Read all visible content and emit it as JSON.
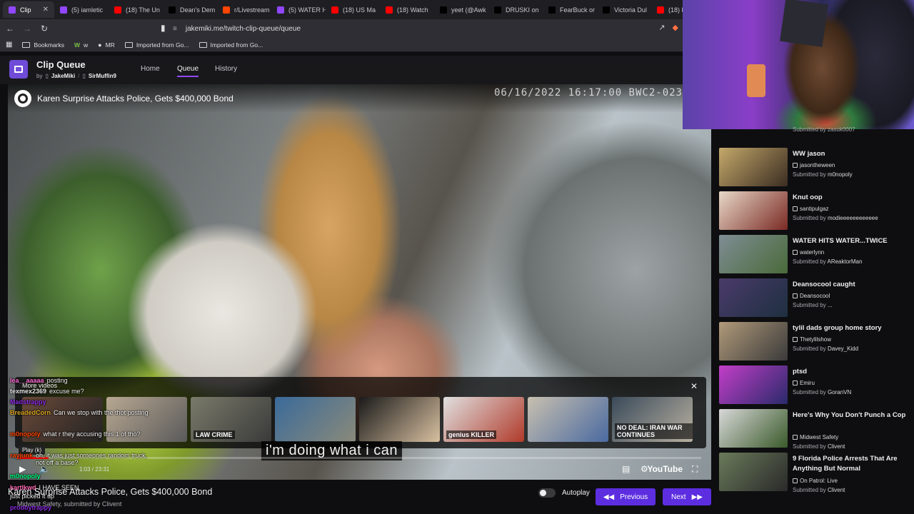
{
  "browser": {
    "tabs": [
      {
        "label": "Clip",
        "color": "#9147ff",
        "active": true
      },
      {
        "label": "(5) iamletic",
        "color": "#9147ff"
      },
      {
        "label": "(18) The Un",
        "color": "#ff0000"
      },
      {
        "label": "Dean's Dem",
        "color": "#000000"
      },
      {
        "label": "r/Livestream",
        "color": "#ff4500"
      },
      {
        "label": "(5) WATER H",
        "color": "#9147ff"
      },
      {
        "label": "(18) US Ma",
        "color": "#ff0000"
      },
      {
        "label": "(18) Watch",
        "color": "#ff0000"
      },
      {
        "label": "yeet (@Awk",
        "color": "#000000"
      },
      {
        "label": "DRUSKI on",
        "color": "#000000"
      },
      {
        "label": "FearBuck or",
        "color": "#000000"
      },
      {
        "label": "Victoria Dul",
        "color": "#000000"
      },
      {
        "label": "(18) L",
        "color": "#ff0000"
      }
    ],
    "url": "jakemiki.me/twitch-clip-queue/queue",
    "bookmarks": [
      "Bookmarks",
      "w",
      "MR",
      "Imported from Go...",
      "Imported from Go..."
    ]
  },
  "app": {
    "title": "Clip Queue",
    "by": "by",
    "author1": "JakeMiki",
    "author2": "SirMuffin9",
    "nav": [
      "Home",
      "Queue",
      "History"
    ]
  },
  "player": {
    "video_title": "Karen Surprise Attacks Police, Gets $400,000 Bond",
    "stamp": "06/16/2022 16:17:00   BWC2-023",
    "more_videos": "More videos",
    "caption": "i'm doing what i can",
    "time": "1:03 / 23:31",
    "play_tooltip": "Play (k)",
    "youtube": "YouTube",
    "progress": 0.045,
    "thumb_labels": [
      "",
      "",
      "LAW CRIME",
      "",
      "",
      "genius KILLER",
      "",
      "NO DEAL: IRAN WAR CONTINUES"
    ]
  },
  "chat": [
    {
      "user": "lea__aaaaa",
      "color": "#ff6ad5",
      "msg": "posting"
    },
    {
      "user": "texmex2369",
      "color": "#e8e8e8",
      "msg": "excuse me?"
    },
    {
      "user": "Madstrappy",
      "color": "#8a2be2",
      "msg": ""
    },
    {
      "user": "BreadedCorn",
      "color": "#daa520",
      "msg": "Can we stop with the thot posting"
    },
    {
      "user": "m0nopoly",
      "color": "#ff4500",
      "msg": "what r they accusing this 1 of tho?"
    },
    {
      "user": "rayjunk",
      "color": "#ff4500",
      "msg": "oh, it was just someones random truck, not off a base?"
    },
    {
      "user": "m0nopoly",
      "color": "#00ff7f",
      "msg": ""
    },
    {
      "user": "kartlkwd",
      "color": "#ff69b4",
      "msg": "I HAVE SEEN"
    },
    {
      "user": "",
      "color": "#ffffff",
      "msg": "just picked it up"
    },
    {
      "user": "prodbytrappy",
      "color": "#8a2be2",
      "msg": ""
    }
  ],
  "current": {
    "title": "Karen Surprise Attacks Police, Gets $400,000 Bond",
    "channel": "Midwest Safety",
    "submitted_by_label": "submitted by",
    "submitter": "Clivent",
    "autoplay": "Autoplay",
    "previous": "Previous",
    "next": "Next"
  },
  "queue": [
    {
      "title": "WW jason",
      "channel": "jasontheween",
      "submitter": "m0nopoly",
      "c1": "#c4a86a",
      "c2": "#3b2d22"
    },
    {
      "title": "Knut oop",
      "channel": "santipulgaz",
      "submitter": "modieeeeeeeeeeee",
      "c1": "#e8d8c8",
      "c2": "#7a2a24"
    },
    {
      "title": "WATER HITS WATER...TWICE",
      "channel": "waterlynn",
      "submitter": "AReaktorMan",
      "c1": "#7f8d94",
      "c2": "#4a6a3a"
    },
    {
      "title": "Deansocool caught",
      "channel": "Deansocool",
      "submitter": "...",
      "c1": "#4a3a6a",
      "c2": "#1e3040"
    },
    {
      "title": "tylil dads group home story",
      "channel": "Thetylilshow",
      "submitter": "Davey_Kidd",
      "c1": "#b09a7a",
      "c2": "#3a3a3a"
    },
    {
      "title": "ptsd",
      "channel": "Emiru",
      "submitter": "GoranVN",
      "c1": "#c23ec8",
      "c2": "#2a2a6a"
    },
    {
      "title": "Here's Why You Don't Punch a Cop",
      "channel": "Midwest Safety",
      "submitter": "Clivent",
      "c1": "#d8d8d8",
      "c2": "#3a5a2a"
    },
    {
      "title": "9 Florida Police Arrests That Are Anything But Normal",
      "channel": "On Patrol: Live",
      "submitter": "Clivent",
      "c1": "#6a7a5a",
      "c2": "#2a2a2a"
    }
  ],
  "queue_prev_submitter": "zasuk0007",
  "submitted_by": "Submitted by"
}
